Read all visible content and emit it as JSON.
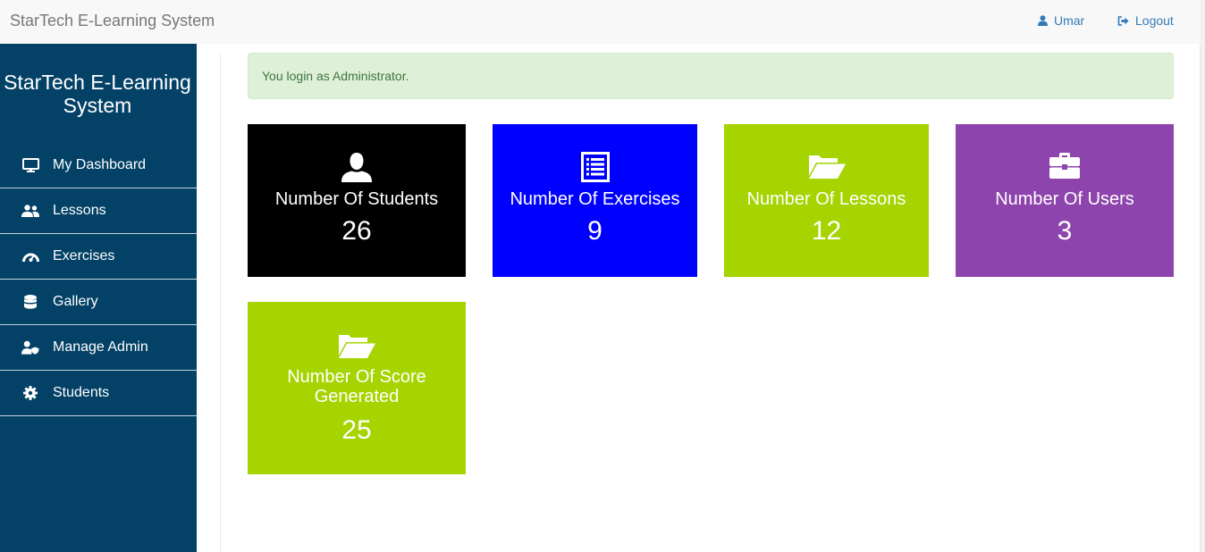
{
  "navbar": {
    "brand": "StarTech E-Learning System",
    "user_label": "Umar",
    "logout_label": "Logout",
    "user_icon": "user-icon",
    "logout_icon": "logout-icon",
    "link_color": "#337ab7"
  },
  "sidebar": {
    "title": "StarTech E-Learning System",
    "background": "#034166",
    "items": [
      {
        "label": "My Dashboard",
        "icon": "monitor-icon"
      },
      {
        "label": "Lessons",
        "icon": "users-icon"
      },
      {
        "label": "Exercises",
        "icon": "gauge-icon"
      },
      {
        "label": "Gallery",
        "icon": "database-icon"
      },
      {
        "label": "Manage Admin",
        "icon": "user-shield-icon"
      },
      {
        "label": "Students",
        "icon": "gear-icon"
      }
    ]
  },
  "alert": {
    "message": "You login as Administrator."
  },
  "tiles": [
    {
      "label": "Number Of Students",
      "value": "26",
      "icon": "user-silhouette-icon",
      "color": "#000000"
    },
    {
      "label": "Number Of Exercises",
      "value": "9",
      "icon": "list-icon",
      "color": "#0000fe"
    },
    {
      "label": "Number Of Lessons",
      "value": "12",
      "icon": "folder-open-icon",
      "color": "#a5d400"
    },
    {
      "label": "Number Of Users",
      "value": "3",
      "icon": "briefcase-icon",
      "color": "#8e44ad"
    },
    {
      "label": "Number Of Score Generated",
      "value": "25",
      "icon": "folder-open-icon",
      "color": "#a5d400"
    }
  ]
}
